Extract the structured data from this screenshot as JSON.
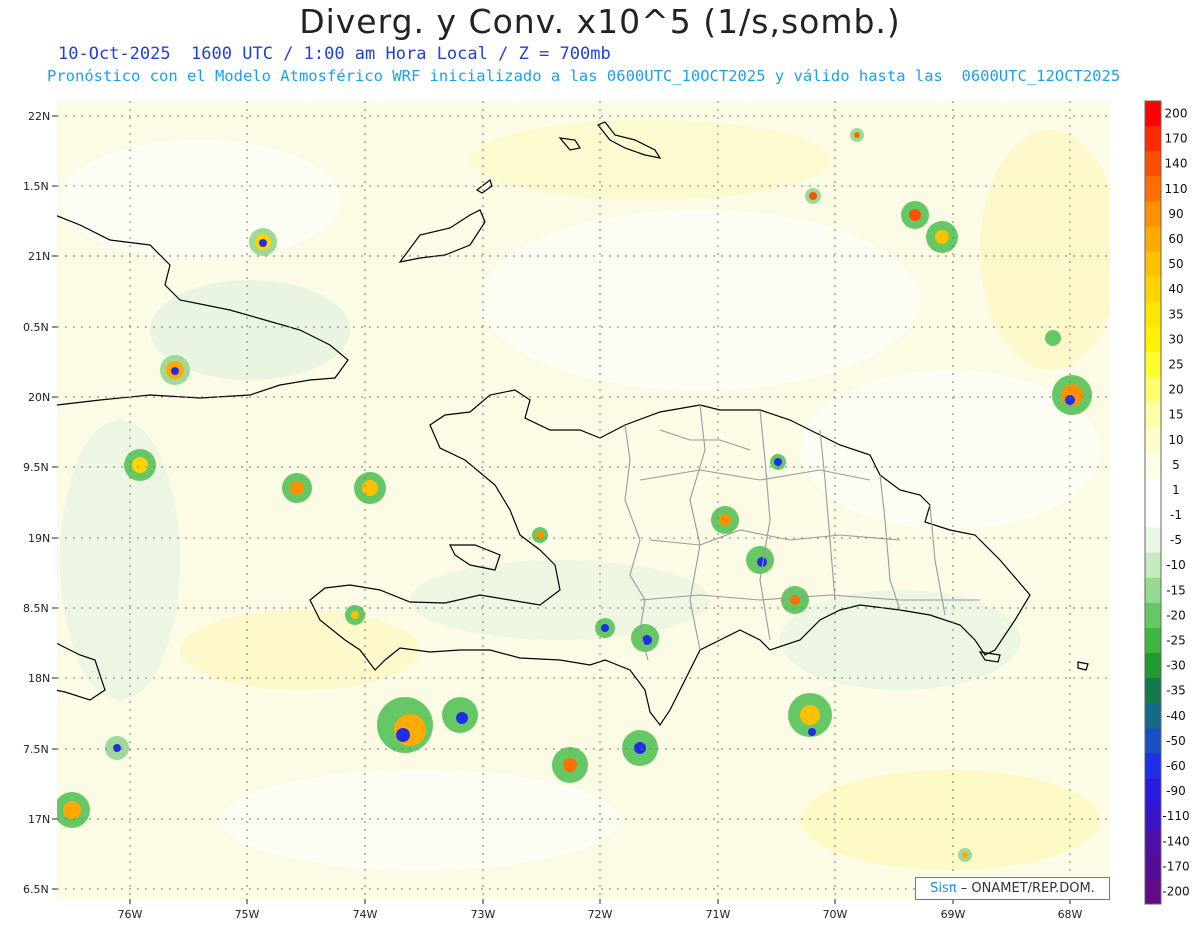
{
  "title": "Diverg. y Conv. x10^5 (1/s,somb.)",
  "subtitle_line1": "10-Oct-2025  1600 UTC / 1:00 am Hora Local / Z = 700mb",
  "subtitle_line2": "Pronóstico con el Modelo Atmosférico WRF inicializado a las 0600UTC_10OCT2025 y válido hasta las  0600UTC_12OCT2025",
  "lat_labels": [
    "22N",
    "1.5N",
    "21N",
    "0.5N",
    "20N",
    "9.5N",
    "19N",
    "8.5N",
    "18N",
    "7.5N",
    "17N",
    "6.5N"
  ],
  "lon_labels": [
    "76W",
    "75W",
    "74W",
    "73W",
    "72W",
    "71W",
    "70W",
    "69W",
    "68W"
  ],
  "colorbar": {
    "labels": [
      "200",
      "170",
      "140",
      "110",
      "90",
      "60",
      "50",
      "40",
      "35",
      "30",
      "25",
      "20",
      "15",
      "10",
      "5",
      "1",
      "-1",
      "-5",
      "-10",
      "-15",
      "-20",
      "-25",
      "-30",
      "-35",
      "-40",
      "-50",
      "-60",
      "-90",
      "-110",
      "-140",
      "-170",
      "-200"
    ],
    "colors": [
      "#ff0000",
      "#ff2a00",
      "#ff5000",
      "#ff7000",
      "#ff9000",
      "#ffaa00",
      "#ffc000",
      "#ffd400",
      "#ffe600",
      "#fff200",
      "#ffff30",
      "#ffff70",
      "#ffffa8",
      "#ffffcc",
      "#ffffe8",
      "#ffffff",
      "#ffffff",
      "#e8f6e4",
      "#c4ebc0",
      "#96d992",
      "#66c865",
      "#3fb540",
      "#1e9a30",
      "#157a4a",
      "#156a8a",
      "#1a4fc2",
      "#1f2fe8",
      "#2a1ae0",
      "#3a14c8",
      "#4a10a8",
      "#560c96",
      "#620a88"
    ]
  },
  "colors": {
    "map_bg": "#fbfbe6",
    "grid": "#777777",
    "coast": "#000000",
    "province": "#999999",
    "title": "#222222",
    "sub1": "#1f3fe0",
    "sub2": "#1aa0f0"
  },
  "credit": {
    "sis": "Sisπ",
    "rest": "– ONAMET/REP.DOM."
  }
}
